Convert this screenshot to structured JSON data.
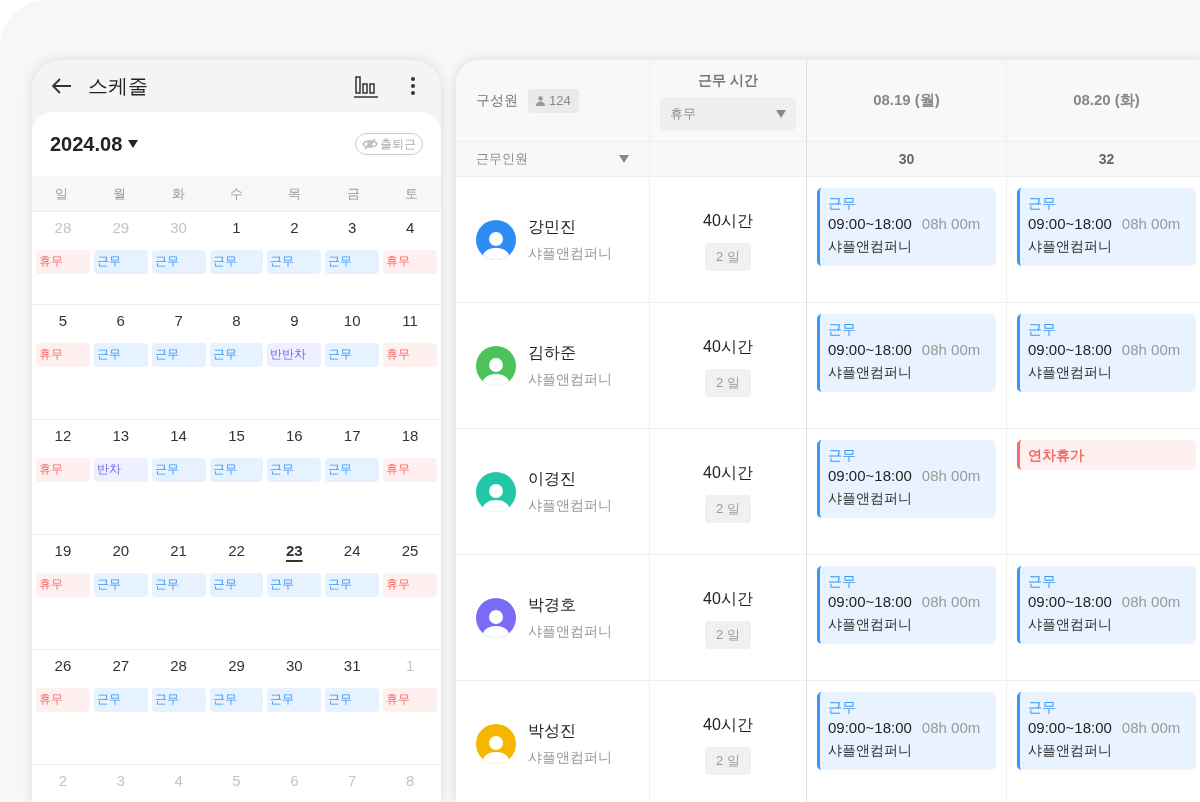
{
  "phone": {
    "title": "스케줄",
    "month": "2024.08",
    "toggle_label": "출퇴근",
    "weekdays": [
      "일",
      "월",
      "화",
      "수",
      "목",
      "금",
      "토"
    ],
    "weeks": [
      {
        "days": [
          {
            "date": "28",
            "muted": true,
            "today": false,
            "event": {
              "kind": "off",
              "label": "휴무"
            }
          },
          {
            "date": "29",
            "muted": true,
            "today": false,
            "event": {
              "kind": "work",
              "label": "근무"
            }
          },
          {
            "date": "30",
            "muted": true,
            "today": false,
            "event": {
              "kind": "work",
              "label": "근무"
            }
          },
          {
            "date": "1",
            "muted": false,
            "today": false,
            "event": {
              "kind": "work",
              "label": "근무"
            }
          },
          {
            "date": "2",
            "muted": false,
            "today": false,
            "event": {
              "kind": "work",
              "label": "근무"
            }
          },
          {
            "date": "3",
            "muted": false,
            "today": false,
            "event": {
              "kind": "work",
              "label": "근무"
            }
          },
          {
            "date": "4",
            "muted": false,
            "today": false,
            "event": {
              "kind": "off",
              "label": "휴무"
            }
          }
        ]
      },
      {
        "days": [
          {
            "date": "5",
            "muted": false,
            "today": false,
            "event": {
              "kind": "off",
              "label": "휴무"
            }
          },
          {
            "date": "6",
            "muted": false,
            "today": false,
            "event": {
              "kind": "work",
              "label": "근무"
            }
          },
          {
            "date": "7",
            "muted": false,
            "today": false,
            "event": {
              "kind": "work",
              "label": "근무"
            }
          },
          {
            "date": "8",
            "muted": false,
            "today": false,
            "event": {
              "kind": "work",
              "label": "근무"
            }
          },
          {
            "date": "9",
            "muted": false,
            "today": false,
            "event": {
              "kind": "half",
              "label": "반반차"
            }
          },
          {
            "date": "10",
            "muted": false,
            "today": false,
            "event": {
              "kind": "work",
              "label": "근무"
            }
          },
          {
            "date": "11",
            "muted": false,
            "today": false,
            "event": {
              "kind": "off",
              "label": "휴무"
            }
          }
        ]
      },
      {
        "days": [
          {
            "date": "12",
            "muted": false,
            "today": false,
            "event": {
              "kind": "off",
              "label": "휴무"
            }
          },
          {
            "date": "13",
            "muted": false,
            "today": false,
            "event": {
              "kind": "half",
              "label": "반차"
            }
          },
          {
            "date": "14",
            "muted": false,
            "today": false,
            "event": {
              "kind": "work",
              "label": "근무"
            }
          },
          {
            "date": "15",
            "muted": false,
            "today": false,
            "event": {
              "kind": "work",
              "label": "근무"
            }
          },
          {
            "date": "16",
            "muted": false,
            "today": false,
            "event": {
              "kind": "work",
              "label": "근무"
            }
          },
          {
            "date": "17",
            "muted": false,
            "today": false,
            "event": {
              "kind": "work",
              "label": "근무"
            }
          },
          {
            "date": "18",
            "muted": false,
            "today": false,
            "event": {
              "kind": "off",
              "label": "휴무"
            }
          }
        ]
      },
      {
        "days": [
          {
            "date": "19",
            "muted": false,
            "today": false,
            "event": {
              "kind": "off",
              "label": "휴무"
            }
          },
          {
            "date": "20",
            "muted": false,
            "today": false,
            "event": {
              "kind": "work",
              "label": "근무"
            }
          },
          {
            "date": "21",
            "muted": false,
            "today": false,
            "event": {
              "kind": "work",
              "label": "근무"
            }
          },
          {
            "date": "22",
            "muted": false,
            "today": false,
            "event": {
              "kind": "work",
              "label": "근무"
            }
          },
          {
            "date": "23",
            "muted": false,
            "today": true,
            "event": {
              "kind": "work",
              "label": "근무"
            }
          },
          {
            "date": "24",
            "muted": false,
            "today": false,
            "event": {
              "kind": "work",
              "label": "근무"
            }
          },
          {
            "date": "25",
            "muted": false,
            "today": false,
            "event": {
              "kind": "off",
              "label": "휴무"
            }
          }
        ]
      },
      {
        "days": [
          {
            "date": "26",
            "muted": false,
            "today": false,
            "event": {
              "kind": "off",
              "label": "휴무"
            }
          },
          {
            "date": "27",
            "muted": false,
            "today": false,
            "event": {
              "kind": "work",
              "label": "근무"
            }
          },
          {
            "date": "28",
            "muted": false,
            "today": false,
            "event": {
              "kind": "work",
              "label": "근무"
            }
          },
          {
            "date": "29",
            "muted": false,
            "today": false,
            "event": {
              "kind": "work",
              "label": "근무"
            }
          },
          {
            "date": "30",
            "muted": false,
            "today": false,
            "event": {
              "kind": "work",
              "label": "근무"
            }
          },
          {
            "date": "31",
            "muted": false,
            "today": false,
            "event": {
              "kind": "work",
              "label": "근무"
            }
          },
          {
            "date": "1",
            "muted": true,
            "today": false,
            "event": {
              "kind": "off",
              "label": "휴무"
            }
          }
        ]
      },
      {
        "days": [
          {
            "date": "2",
            "muted": true,
            "today": false
          },
          {
            "date": "3",
            "muted": true,
            "today": false
          },
          {
            "date": "4",
            "muted": true,
            "today": false
          },
          {
            "date": "5",
            "muted": true,
            "today": false
          },
          {
            "date": "6",
            "muted": true,
            "today": false
          },
          {
            "date": "7",
            "muted": true,
            "today": false
          },
          {
            "date": "8",
            "muted": true,
            "today": false
          }
        ]
      }
    ]
  },
  "table": {
    "member_header": "구성원",
    "member_count": "124",
    "hours_header": "근무 시간",
    "hours_filter": "휴무",
    "member_filter": "근무인원",
    "days": [
      {
        "label": "08.19 (월)",
        "count": "30"
      },
      {
        "label": "08.20 (화)",
        "count": "32"
      }
    ],
    "rows": [
      {
        "name": "강민진",
        "company": "샤플앤컴퍼니",
        "color": "#2f8cf5",
        "hours": "40시간",
        "days_badge": "2 일",
        "shifts": [
          {
            "kind": "work",
            "title": "근무",
            "time": "09:00~18:00",
            "duration": "08h 00m",
            "place": "샤플앤컴퍼니"
          },
          {
            "kind": "work",
            "title": "근무",
            "time": "09:00~18:00",
            "duration": "08h 00m",
            "place": "샤플앤컴퍼니"
          }
        ]
      },
      {
        "name": "김하준",
        "company": "샤플앤컴퍼니",
        "color": "#4cc35a",
        "hours": "40시간",
        "days_badge": "2 일",
        "shifts": [
          {
            "kind": "work",
            "title": "근무",
            "time": "09:00~18:00",
            "duration": "08h 00m",
            "place": "샤플앤컴퍼니"
          },
          {
            "kind": "work",
            "title": "근무",
            "time": "09:00~18:00",
            "duration": "08h 00m",
            "place": "샤플앤컴퍼니"
          }
        ]
      },
      {
        "name": "이경진",
        "company": "샤플앤컴퍼니",
        "color": "#22c7a8",
        "hours": "40시간",
        "days_badge": "2 일",
        "shifts": [
          {
            "kind": "work",
            "title": "근무",
            "time": "09:00~18:00",
            "duration": "08h 00m",
            "place": "샤플앤컴퍼니"
          },
          {
            "kind": "leave",
            "title": "연차휴가"
          }
        ]
      },
      {
        "name": "박경호",
        "company": "샤플앤컴퍼니",
        "color": "#7b6cf6",
        "hours": "40시간",
        "days_badge": "2 일",
        "shifts": [
          {
            "kind": "work",
            "title": "근무",
            "time": "09:00~18:00",
            "duration": "08h 00m",
            "place": "샤플앤컴퍼니"
          },
          {
            "kind": "work",
            "title": "근무",
            "time": "09:00~18:00",
            "duration": "08h 00m",
            "place": "샤플앤컴퍼니"
          }
        ]
      },
      {
        "name": "박성진",
        "company": "샤플앤컴퍼니",
        "color": "#f6b600",
        "hours": "40시간",
        "days_badge": "2 일",
        "shifts": [
          {
            "kind": "work",
            "title": "근무",
            "time": "09:00~18:00",
            "duration": "08h 00m",
            "place": "샤플앤컴퍼니"
          },
          {
            "kind": "work",
            "title": "근무",
            "time": "09:00~18:00",
            "duration": "08h 00m",
            "place": "샤플앤컴퍼니"
          }
        ]
      }
    ]
  }
}
